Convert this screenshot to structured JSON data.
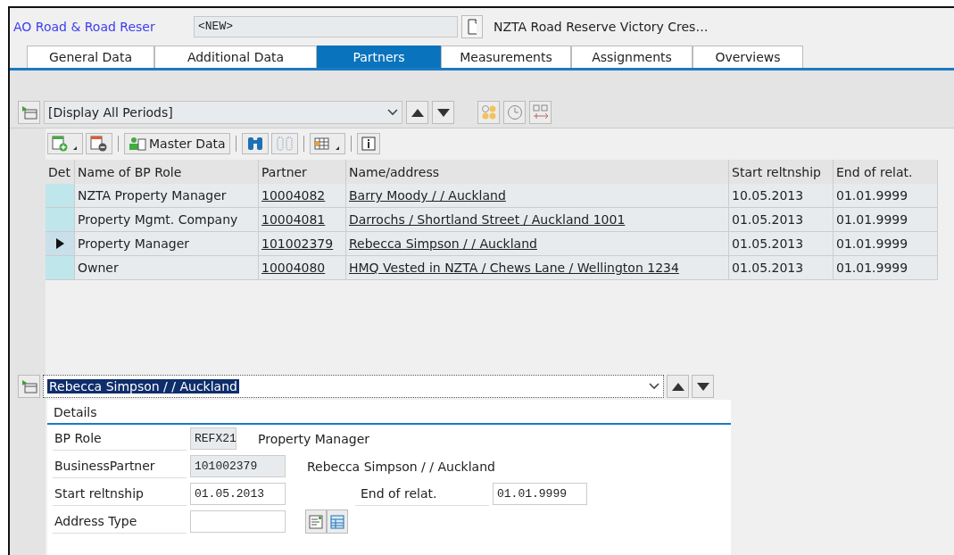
{
  "header": {
    "object_type": "AO Road & Road Reser",
    "number_field": {
      "value": "<NEW>"
    },
    "description": "NZTA Road Reserve Victory Cres…"
  },
  "tabs": [
    {
      "label": "General Data",
      "selected": false
    },
    {
      "label": "Additional Data",
      "selected": false
    },
    {
      "label": "Partners",
      "selected": true
    },
    {
      "label": "Measurements",
      "selected": false
    },
    {
      "label": "Assignments",
      "selected": false
    },
    {
      "label": "Overviews",
      "selected": false
    }
  ],
  "period_selector": {
    "value": "[Display All Periods]"
  },
  "toolbar": {
    "master_data_label": "Master Data"
  },
  "table": {
    "selector_column": "Det",
    "columns": [
      "Name of BP Role",
      "Partner",
      "Name/address",
      "Start reltnship",
      "End of relat."
    ],
    "rows": [
      {
        "selected": false,
        "cells": [
          "NZTA Property Manager",
          "10004082",
          "Barry Moody / / Auckland",
          "10.05.2013",
          "01.01.9999"
        ]
      },
      {
        "selected": false,
        "cells": [
          "Property Mgmt. Company",
          "10004081",
          "Darrochs / Shortland Street / Auckland 1001",
          "01.05.2013",
          "01.01.9999"
        ]
      },
      {
        "selected": true,
        "cells": [
          "Property Manager",
          "101002379",
          "Rebecca Simpson / / Auckland",
          "01.05.2013",
          "01.01.9999"
        ]
      },
      {
        "selected": false,
        "cells": [
          "Owner",
          "10004080",
          "HMQ Vested in NZTA / Chews Lane / Wellington 1234",
          "01.05.2013",
          "01.01.9999"
        ]
      }
    ]
  },
  "detail_selector": {
    "value": "Rebecca Simpson / / Auckland"
  },
  "details": {
    "title": "Details",
    "rows": [
      {
        "kind": "text",
        "label": "BP Role",
        "value": "REFX21",
        "readonly": true,
        "text": "Property Manager"
      },
      {
        "kind": "text",
        "label": "BusinessPartner",
        "value": "101002379",
        "readonly": true,
        "text": "Rebecca Simpson / / Auckland"
      },
      {
        "kind": "field",
        "label": "Start reltnship",
        "value": "01.05.2013",
        "readonly": false,
        "second_label": "End of relat.",
        "second_value": "01.01.9999"
      },
      {
        "kind": "buttons",
        "label": "Address Type",
        "readonly": false
      }
    ]
  }
}
